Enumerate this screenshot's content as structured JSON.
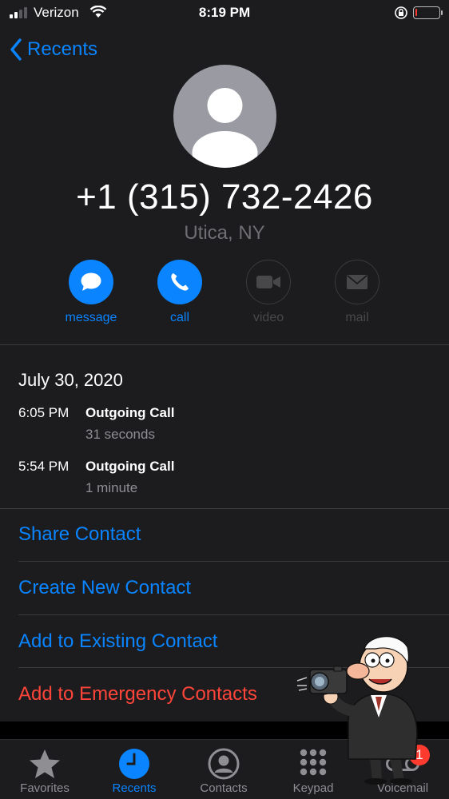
{
  "status_bar": {
    "carrier": "Verizon",
    "time": "8:19 PM",
    "signal_bars_active": 2,
    "battery_level_percent": 5,
    "battery_color": "#ff3b30"
  },
  "nav": {
    "back_label": "Recents",
    "back_icon": "chevron-left-icon"
  },
  "contact": {
    "avatar_icon": "person-icon",
    "phone_number": "+1 (315) 732-2426",
    "location": "Utica, NY"
  },
  "actions": [
    {
      "label": "message",
      "icon": "message-bubble-icon",
      "enabled": true
    },
    {
      "label": "call",
      "icon": "phone-icon",
      "enabled": true
    },
    {
      "label": "video",
      "icon": "video-camera-icon",
      "enabled": false
    },
    {
      "label": "mail",
      "icon": "envelope-icon",
      "enabled": false
    }
  ],
  "call_log": {
    "date": "July 30, 2020",
    "calls": [
      {
        "time": "6:05 PM",
        "type": "Outgoing Call",
        "duration": "31 seconds"
      },
      {
        "time": "5:54 PM",
        "type": "Outgoing Call",
        "duration": "1 minute"
      }
    ]
  },
  "menu": [
    {
      "label": "Share Contact"
    },
    {
      "label": "Create New Contact"
    },
    {
      "label": "Add to Existing Contact"
    },
    {
      "label": "Add to Emergency Contacts"
    }
  ],
  "tabbar": {
    "tabs": [
      {
        "label": "Favorites",
        "icon": "star-icon",
        "active": false
      },
      {
        "label": "Recents",
        "icon": "clock-icon",
        "active": true
      },
      {
        "label": "Contacts",
        "icon": "person-circle-icon",
        "active": false
      },
      {
        "label": "Keypad",
        "icon": "keypad-icon",
        "active": false
      },
      {
        "label": "Voicemail",
        "icon": "voicemail-icon",
        "active": false
      }
    ],
    "voicemail_badge": "1"
  },
  "colors": {
    "accent": "#0a84ff",
    "danger": "#ff453a",
    "background": "#1c1c1e"
  }
}
